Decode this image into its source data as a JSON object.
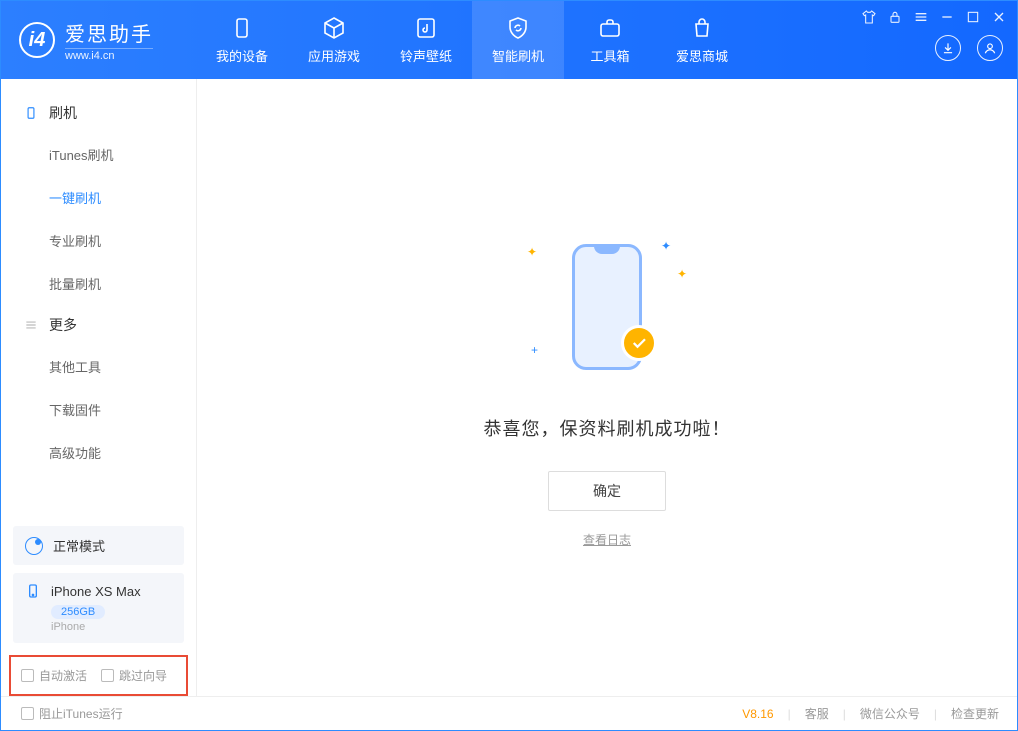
{
  "app": {
    "name": "爱思助手",
    "domain": "www.i4.cn"
  },
  "header": {
    "tabs": [
      {
        "label": "我的设备"
      },
      {
        "label": "应用游戏"
      },
      {
        "label": "铃声壁纸"
      },
      {
        "label": "智能刷机"
      },
      {
        "label": "工具箱"
      },
      {
        "label": "爱思商城"
      }
    ]
  },
  "sidebar": {
    "group1_title": "刷机",
    "items1": [
      "iTunes刷机",
      "一键刷机",
      "专业刷机",
      "批量刷机"
    ],
    "group2_title": "更多",
    "items2": [
      "其他工具",
      "下载固件",
      "高级功能"
    ]
  },
  "device_panel": {
    "mode_label": "正常模式",
    "device_name": "iPhone XS Max",
    "capacity": "256GB",
    "device_type": "iPhone"
  },
  "options": {
    "auto_activate": "自动激活",
    "skip_wizard": "跳过向导"
  },
  "main": {
    "success_message": "恭喜您，保资料刷机成功啦！",
    "ok_button": "确定",
    "view_log": "查看日志"
  },
  "footer": {
    "block_itunes": "阻止iTunes运行",
    "version": "V8.16",
    "links": [
      "客服",
      "微信公众号",
      "检查更新"
    ]
  }
}
